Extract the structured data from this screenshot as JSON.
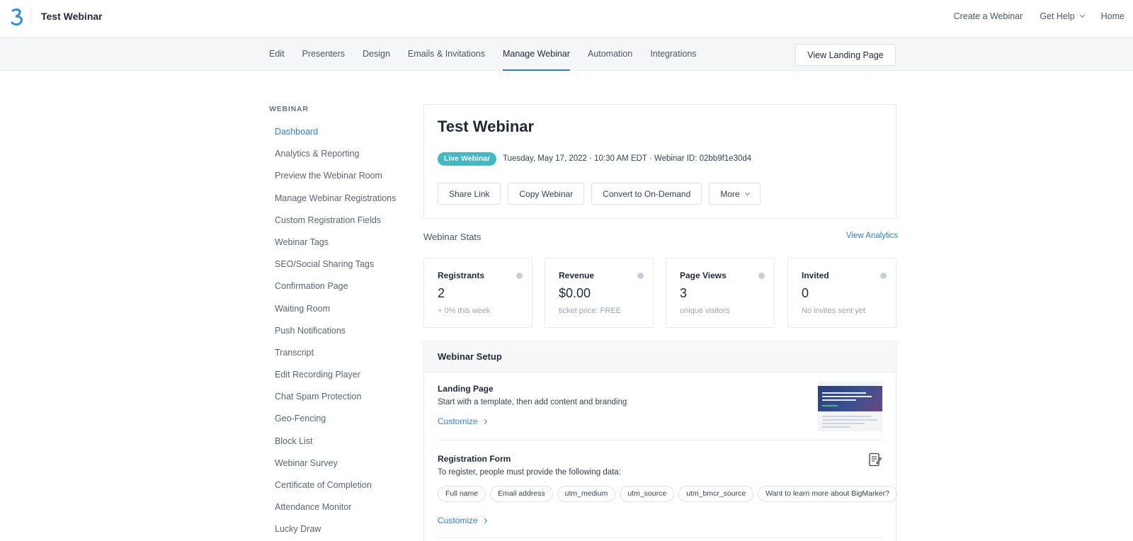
{
  "header": {
    "title": "Test Webinar",
    "nav": [
      "Create a Webinar",
      "Get Help",
      "Home"
    ]
  },
  "tabs": [
    "Edit",
    "Presenters",
    "Design",
    "Emails & Invitations",
    "Manage Webinar",
    "Automation",
    "Integrations"
  ],
  "active_tab": "Manage Webinar",
  "view_landing_label": "View Landing Page",
  "sidebar": {
    "heading": "WEBINAR",
    "items": [
      "Dashboard",
      "Analytics & Reporting",
      "Preview the Webinar Room",
      "Manage Webinar Registrations",
      "Custom Registration Fields",
      "Webinar Tags",
      "SEO/Social Sharing Tags",
      "Confirmation Page",
      "Waiting Room",
      "Push Notifications",
      "Transcript",
      "Edit Recording Player",
      "Chat Spam Protection",
      "Geo-Fencing",
      "Block List",
      "Webinar Survey",
      "Certificate of Completion",
      "Attendance Monitor",
      "Lucky Draw"
    ],
    "active": "Dashboard"
  },
  "main": {
    "title": "Test Webinar",
    "badge": "Live Webinar",
    "meta": "Tuesday, May 17, 2022 · 10:30 AM EDT · Webinar ID: 02bb9f1e30d4",
    "actions": [
      "Share Link",
      "Copy Webinar",
      "Convert to On-Demand",
      "More"
    ]
  },
  "stats": {
    "title": "Webinar Stats",
    "link": "View Analytics",
    "cards": [
      {
        "label": "Registrants",
        "value": "2",
        "sub": "+ 0% this week"
      },
      {
        "label": "Revenue",
        "value": "$0.00",
        "sub": "ticket price: FREE"
      },
      {
        "label": "Page Views",
        "value": "3",
        "sub": "unique visitors"
      },
      {
        "label": "Invited",
        "value": "0",
        "sub": "No invites sent yet"
      }
    ]
  },
  "setup": {
    "title": "Webinar Setup",
    "landing": {
      "title": "Landing Page",
      "desc": "Start with a template, then add content and branding",
      "link": "Customize"
    },
    "registration": {
      "title": "Registration Form",
      "desc": "To register, people must provide the following data:",
      "fields": [
        "Full name",
        "Email address",
        "utm_medium",
        "utm_source",
        "utm_bmcr_source",
        "Want to learn more about BigMarker?"
      ],
      "link": "Customize"
    }
  },
  "colors": {
    "accent": "#2f7de1",
    "badge": "#41b8c4"
  }
}
